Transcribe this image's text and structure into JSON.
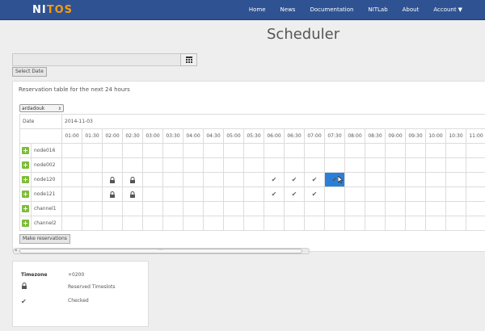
{
  "brand": {
    "logo_part1": "NI",
    "logo_part2": "T",
    "logo_part3": "OS"
  },
  "nav": {
    "items": [
      "Home",
      "News",
      "Documentation",
      "NITLab",
      "About"
    ],
    "account": "Account"
  },
  "page": {
    "title": "Scheduler"
  },
  "date_picker": {
    "value": "",
    "select_label": "Select Date"
  },
  "reservation": {
    "title": "Reservation table for the next 24 hours",
    "user": "ardadouk",
    "date_header": "Date",
    "date_value": "2014-11-03",
    "times": [
      "01:00",
      "01:30",
      "02:00",
      "02:30",
      "03:00",
      "03:30",
      "04:00",
      "04:30",
      "05:00",
      "05:30",
      "06:00",
      "06:30",
      "07:00",
      "07:30",
      "08:00",
      "08:30",
      "09:00",
      "09:30",
      "10:00",
      "10:30",
      "11:00"
    ],
    "rows": [
      {
        "name": "node016",
        "cells": [
          "",
          "",
          "",
          "",
          "",
          "",
          "",
          "",
          "",
          "",
          "",
          "",
          "",
          "",
          "",
          "",
          "",
          "",
          "",
          "",
          ""
        ]
      },
      {
        "name": "node002",
        "cells": [
          "",
          "",
          "",
          "",
          "",
          "",
          "",
          "",
          "",
          "",
          "",
          "",
          "",
          "",
          "",
          "",
          "",
          "",
          "",
          "",
          ""
        ]
      },
      {
        "name": "node120",
        "cells": [
          "",
          "",
          "lock",
          "lock",
          "",
          "",
          "",
          "",
          "",
          "",
          "check",
          "check",
          "check",
          "selected",
          "",
          "",
          "",
          "",
          "",
          "",
          ""
        ]
      },
      {
        "name": "node121",
        "cells": [
          "",
          "",
          "lock",
          "lock",
          "",
          "",
          "",
          "",
          "",
          "",
          "check",
          "check",
          "check",
          "",
          "",
          "",
          "",
          "",
          "",
          "",
          ""
        ]
      },
      {
        "name": "channel1",
        "cells": [
          "",
          "",
          "",
          "",
          "",
          "",
          "",
          "",
          "",
          "",
          "",
          "",
          "",
          "",
          "",
          "",
          "",
          "",
          "",
          "",
          ""
        ]
      },
      {
        "name": "channel2",
        "cells": [
          "",
          "",
          "",
          "",
          "",
          "",
          "",
          "",
          "",
          "",
          "",
          "",
          "",
          "",
          "",
          "",
          "",
          "",
          "",
          "",
          ""
        ]
      }
    ],
    "make_label": "Make reservations"
  },
  "legend": {
    "timezone_label": "Timezone",
    "timezone_value": "+0200",
    "reserved_label": "Reserved Timeslots",
    "checked_label": "Checked"
  },
  "colors": {
    "navbar": "#2f5292",
    "accent": "#f39c12",
    "add": "#7dbd3a",
    "selected": "#2b7fd6"
  }
}
